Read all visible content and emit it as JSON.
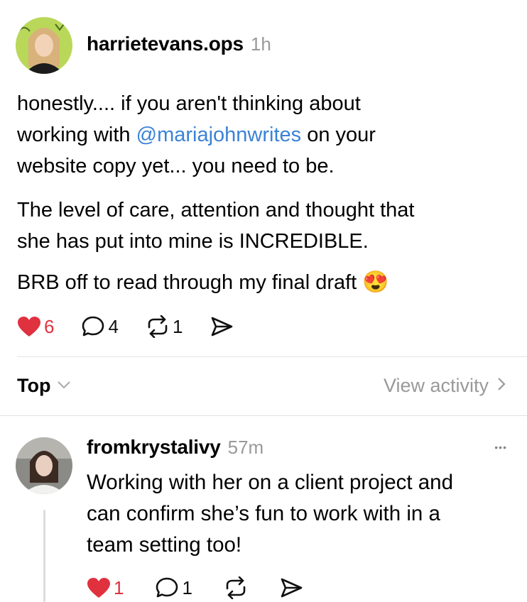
{
  "post": {
    "username": "harrietevans.ops",
    "time": "1h",
    "line1": "honestly.... if you aren't thinking about",
    "line2_pre": "working with ",
    "mention": "@mariajohnwrites",
    "line2_post": " on your",
    "line3": "website copy yet... you need to be.",
    "para2_line1": "The level of care, attention and thought that",
    "para2_line2": "she has put into mine is INCREDIBLE.",
    "para3": "BRB off to read through my final draft",
    "emoji": "😍",
    "likes": "6",
    "comments": "4",
    "reposts": "1"
  },
  "sort": {
    "label": "Top",
    "view_activity": "View activity"
  },
  "reply": {
    "username": "fromkrystalivy",
    "time": "57m",
    "more": "•••",
    "line1": "Working with her on a client project and",
    "line2": "can confirm she’s fun to work with in a",
    "line3": "team setting too!",
    "likes": "1",
    "comments": "1"
  },
  "colors": {
    "like": "#e0313f",
    "mention": "#3b82d6",
    "muted": "#999999"
  },
  "icons": [
    "heart-icon",
    "comment-icon",
    "repost-icon",
    "share-icon",
    "chevron-down-icon",
    "chevron-right-icon",
    "more-icon"
  ]
}
